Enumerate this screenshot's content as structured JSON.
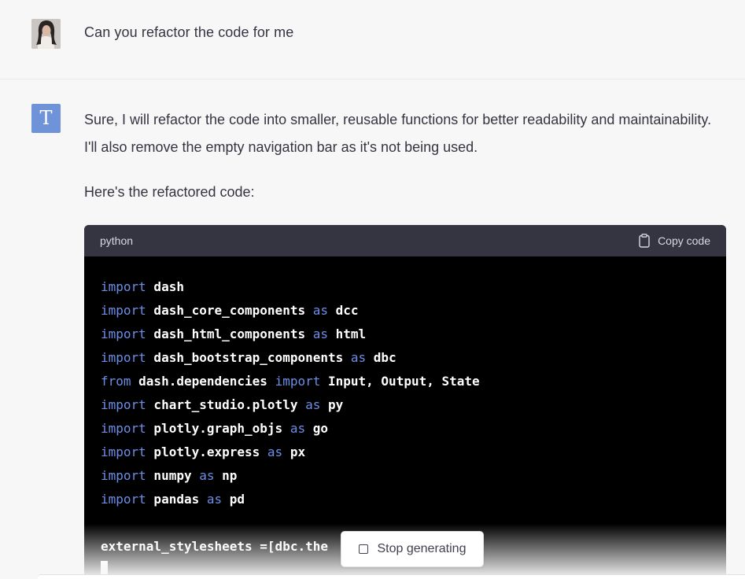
{
  "user_message": {
    "avatar": "user-photo-avatar",
    "text": "Can you refactor the code for me"
  },
  "assistant_message": {
    "avatar_letter": "T",
    "avatar_color": "#6f93d8",
    "paragraph1": "Sure, I will refactor the code into smaller, reusable functions for better readability and maintainability. I'll also remove the empty navigation bar as it's not being used.",
    "paragraph2": "Here's the refactored code:",
    "code_block": {
      "language": "python",
      "copy_label": "Copy code",
      "copy_icon": "clipboard-icon",
      "lines": [
        [
          {
            "t": "import",
            "k": true
          },
          {
            "t": " dash"
          }
        ],
        [
          {
            "t": "import",
            "k": true
          },
          {
            "t": " dash_core_components "
          },
          {
            "t": "as",
            "k": true
          },
          {
            "t": " dcc"
          }
        ],
        [
          {
            "t": "import",
            "k": true
          },
          {
            "t": " dash_html_components "
          },
          {
            "t": "as",
            "k": true
          },
          {
            "t": " html"
          }
        ],
        [
          {
            "t": "import",
            "k": true
          },
          {
            "t": " dash_bootstrap_components "
          },
          {
            "t": "as",
            "k": true
          },
          {
            "t": " dbc"
          }
        ],
        [
          {
            "t": "from",
            "k": true
          },
          {
            "t": " dash.dependencies "
          },
          {
            "t": "import",
            "k": true
          },
          {
            "t": " Input, Output, State"
          }
        ],
        [
          {
            "t": "import",
            "k": true
          },
          {
            "t": " chart_studio.plotly "
          },
          {
            "t": "as",
            "k": true
          },
          {
            "t": " py"
          }
        ],
        [
          {
            "t": "import",
            "k": true
          },
          {
            "t": " plotly.graph_objs "
          },
          {
            "t": "as",
            "k": true
          },
          {
            "t": " go"
          }
        ],
        [
          {
            "t": "import",
            "k": true
          },
          {
            "t": " plotly.express "
          },
          {
            "t": "as",
            "k": true
          },
          {
            "t": " px"
          }
        ],
        [
          {
            "t": "import",
            "k": true
          },
          {
            "t": " numpy "
          },
          {
            "t": "as",
            "k": true
          },
          {
            "t": " np"
          }
        ],
        [
          {
            "t": "import",
            "k": true
          },
          {
            "t": " pandas "
          },
          {
            "t": "as",
            "k": true
          },
          {
            "t": " pd"
          }
        ],
        [],
        [
          {
            "t": "external_stylesheets =[dbc.the"
          }
        ]
      ]
    }
  },
  "stop_button": {
    "label": "Stop generating",
    "icon": "stop-square-icon"
  },
  "colors": {
    "background": "#f7f7f8",
    "code_background": "#000000",
    "code_header": "#343541",
    "keyword": "#6d8ee6"
  }
}
